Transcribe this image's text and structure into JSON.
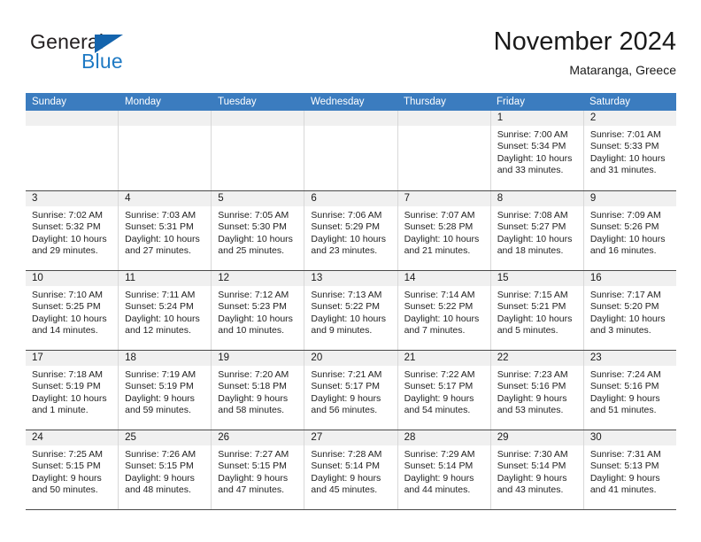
{
  "brand": {
    "name_part1": "General",
    "name_part2": "Blue",
    "triangle_color": "#1464ad",
    "blue_color": "#1f7ac4"
  },
  "header": {
    "title": "November 2024",
    "subtitle": "Mataranga, Greece"
  },
  "theme": {
    "header_row_bg": "#3b7cbf",
    "day_number_bg": "#f0f0f0",
    "grid_line": "#4a4a4a"
  },
  "weekdays": [
    "Sunday",
    "Monday",
    "Tuesday",
    "Wednesday",
    "Thursday",
    "Friday",
    "Saturday"
  ],
  "weeks": [
    [
      {
        "day": "",
        "empty": true,
        "sunrise": "",
        "sunset": "",
        "daylight1": "",
        "daylight2": ""
      },
      {
        "day": "",
        "empty": true,
        "sunrise": "",
        "sunset": "",
        "daylight1": "",
        "daylight2": ""
      },
      {
        "day": "",
        "empty": true,
        "sunrise": "",
        "sunset": "",
        "daylight1": "",
        "daylight2": ""
      },
      {
        "day": "",
        "empty": true,
        "sunrise": "",
        "sunset": "",
        "daylight1": "",
        "daylight2": ""
      },
      {
        "day": "",
        "empty": true,
        "sunrise": "",
        "sunset": "",
        "daylight1": "",
        "daylight2": ""
      },
      {
        "day": "1",
        "empty": false,
        "sunrise": "Sunrise: 7:00 AM",
        "sunset": "Sunset: 5:34 PM",
        "daylight1": "Daylight: 10 hours",
        "daylight2": "and 33 minutes."
      },
      {
        "day": "2",
        "empty": false,
        "sunrise": "Sunrise: 7:01 AM",
        "sunset": "Sunset: 5:33 PM",
        "daylight1": "Daylight: 10 hours",
        "daylight2": "and 31 minutes."
      }
    ],
    [
      {
        "day": "3",
        "empty": false,
        "sunrise": "Sunrise: 7:02 AM",
        "sunset": "Sunset: 5:32 PM",
        "daylight1": "Daylight: 10 hours",
        "daylight2": "and 29 minutes."
      },
      {
        "day": "4",
        "empty": false,
        "sunrise": "Sunrise: 7:03 AM",
        "sunset": "Sunset: 5:31 PM",
        "daylight1": "Daylight: 10 hours",
        "daylight2": "and 27 minutes."
      },
      {
        "day": "5",
        "empty": false,
        "sunrise": "Sunrise: 7:05 AM",
        "sunset": "Sunset: 5:30 PM",
        "daylight1": "Daylight: 10 hours",
        "daylight2": "and 25 minutes."
      },
      {
        "day": "6",
        "empty": false,
        "sunrise": "Sunrise: 7:06 AM",
        "sunset": "Sunset: 5:29 PM",
        "daylight1": "Daylight: 10 hours",
        "daylight2": "and 23 minutes."
      },
      {
        "day": "7",
        "empty": false,
        "sunrise": "Sunrise: 7:07 AM",
        "sunset": "Sunset: 5:28 PM",
        "daylight1": "Daylight: 10 hours",
        "daylight2": "and 21 minutes."
      },
      {
        "day": "8",
        "empty": false,
        "sunrise": "Sunrise: 7:08 AM",
        "sunset": "Sunset: 5:27 PM",
        "daylight1": "Daylight: 10 hours",
        "daylight2": "and 18 minutes."
      },
      {
        "day": "9",
        "empty": false,
        "sunrise": "Sunrise: 7:09 AM",
        "sunset": "Sunset: 5:26 PM",
        "daylight1": "Daylight: 10 hours",
        "daylight2": "and 16 minutes."
      }
    ],
    [
      {
        "day": "10",
        "empty": false,
        "sunrise": "Sunrise: 7:10 AM",
        "sunset": "Sunset: 5:25 PM",
        "daylight1": "Daylight: 10 hours",
        "daylight2": "and 14 minutes."
      },
      {
        "day": "11",
        "empty": false,
        "sunrise": "Sunrise: 7:11 AM",
        "sunset": "Sunset: 5:24 PM",
        "daylight1": "Daylight: 10 hours",
        "daylight2": "and 12 minutes."
      },
      {
        "day": "12",
        "empty": false,
        "sunrise": "Sunrise: 7:12 AM",
        "sunset": "Sunset: 5:23 PM",
        "daylight1": "Daylight: 10 hours",
        "daylight2": "and 10 minutes."
      },
      {
        "day": "13",
        "empty": false,
        "sunrise": "Sunrise: 7:13 AM",
        "sunset": "Sunset: 5:22 PM",
        "daylight1": "Daylight: 10 hours",
        "daylight2": "and 9 minutes."
      },
      {
        "day": "14",
        "empty": false,
        "sunrise": "Sunrise: 7:14 AM",
        "sunset": "Sunset: 5:22 PM",
        "daylight1": "Daylight: 10 hours",
        "daylight2": "and 7 minutes."
      },
      {
        "day": "15",
        "empty": false,
        "sunrise": "Sunrise: 7:15 AM",
        "sunset": "Sunset: 5:21 PM",
        "daylight1": "Daylight: 10 hours",
        "daylight2": "and 5 minutes."
      },
      {
        "day": "16",
        "empty": false,
        "sunrise": "Sunrise: 7:17 AM",
        "sunset": "Sunset: 5:20 PM",
        "daylight1": "Daylight: 10 hours",
        "daylight2": "and 3 minutes."
      }
    ],
    [
      {
        "day": "17",
        "empty": false,
        "sunrise": "Sunrise: 7:18 AM",
        "sunset": "Sunset: 5:19 PM",
        "daylight1": "Daylight: 10 hours",
        "daylight2": "and 1 minute."
      },
      {
        "day": "18",
        "empty": false,
        "sunrise": "Sunrise: 7:19 AM",
        "sunset": "Sunset: 5:19 PM",
        "daylight1": "Daylight: 9 hours",
        "daylight2": "and 59 minutes."
      },
      {
        "day": "19",
        "empty": false,
        "sunrise": "Sunrise: 7:20 AM",
        "sunset": "Sunset: 5:18 PM",
        "daylight1": "Daylight: 9 hours",
        "daylight2": "and 58 minutes."
      },
      {
        "day": "20",
        "empty": false,
        "sunrise": "Sunrise: 7:21 AM",
        "sunset": "Sunset: 5:17 PM",
        "daylight1": "Daylight: 9 hours",
        "daylight2": "and 56 minutes."
      },
      {
        "day": "21",
        "empty": false,
        "sunrise": "Sunrise: 7:22 AM",
        "sunset": "Sunset: 5:17 PM",
        "daylight1": "Daylight: 9 hours",
        "daylight2": "and 54 minutes."
      },
      {
        "day": "22",
        "empty": false,
        "sunrise": "Sunrise: 7:23 AM",
        "sunset": "Sunset: 5:16 PM",
        "daylight1": "Daylight: 9 hours",
        "daylight2": "and 53 minutes."
      },
      {
        "day": "23",
        "empty": false,
        "sunrise": "Sunrise: 7:24 AM",
        "sunset": "Sunset: 5:16 PM",
        "daylight1": "Daylight: 9 hours",
        "daylight2": "and 51 minutes."
      }
    ],
    [
      {
        "day": "24",
        "empty": false,
        "sunrise": "Sunrise: 7:25 AM",
        "sunset": "Sunset: 5:15 PM",
        "daylight1": "Daylight: 9 hours",
        "daylight2": "and 50 minutes."
      },
      {
        "day": "25",
        "empty": false,
        "sunrise": "Sunrise: 7:26 AM",
        "sunset": "Sunset: 5:15 PM",
        "daylight1": "Daylight: 9 hours",
        "daylight2": "and 48 minutes."
      },
      {
        "day": "26",
        "empty": false,
        "sunrise": "Sunrise: 7:27 AM",
        "sunset": "Sunset: 5:15 PM",
        "daylight1": "Daylight: 9 hours",
        "daylight2": "and 47 minutes."
      },
      {
        "day": "27",
        "empty": false,
        "sunrise": "Sunrise: 7:28 AM",
        "sunset": "Sunset: 5:14 PM",
        "daylight1": "Daylight: 9 hours",
        "daylight2": "and 45 minutes."
      },
      {
        "day": "28",
        "empty": false,
        "sunrise": "Sunrise: 7:29 AM",
        "sunset": "Sunset: 5:14 PM",
        "daylight1": "Daylight: 9 hours",
        "daylight2": "and 44 minutes."
      },
      {
        "day": "29",
        "empty": false,
        "sunrise": "Sunrise: 7:30 AM",
        "sunset": "Sunset: 5:14 PM",
        "daylight1": "Daylight: 9 hours",
        "daylight2": "and 43 minutes."
      },
      {
        "day": "30",
        "empty": false,
        "sunrise": "Sunrise: 7:31 AM",
        "sunset": "Sunset: 5:13 PM",
        "daylight1": "Daylight: 9 hours",
        "daylight2": "and 41 minutes."
      }
    ]
  ]
}
